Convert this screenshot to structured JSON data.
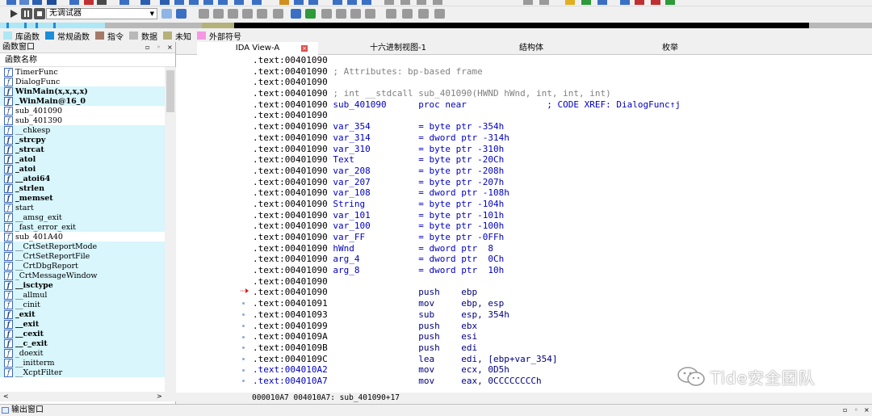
{
  "toolbar": {
    "debugger_select": "无调试器"
  },
  "nav_legend": [
    {
      "label": "库函数",
      "color": "#aee7f5"
    },
    {
      "label": "常规函数",
      "color": "#1a8ed8"
    },
    {
      "label": "指令",
      "color": "#a5786a"
    },
    {
      "label": "数据",
      "color": "#b8b8b8"
    },
    {
      "label": "未知",
      "color": "#b5b17a"
    },
    {
      "label": "外部符号",
      "color": "#f598e3"
    }
  ],
  "functions_window": {
    "title": "函数窗口",
    "column_header": "函数名称",
    "items": [
      {
        "name": "TimerFunc",
        "lib": false,
        "bold": false
      },
      {
        "name": "DialogFunc",
        "lib": false,
        "bold": false
      },
      {
        "name": "WinMain(x,x,x,x)",
        "lib": true,
        "bold": true
      },
      {
        "name": "_WinMain@16_0",
        "lib": true,
        "bold": true
      },
      {
        "name": "sub_401090",
        "lib": false,
        "bold": false
      },
      {
        "name": "sub_401390",
        "lib": false,
        "bold": false
      },
      {
        "name": "__chkesp",
        "lib": true,
        "bold": false
      },
      {
        "name": "_strcpy",
        "lib": true,
        "bold": true
      },
      {
        "name": "_strcat",
        "lib": true,
        "bold": true
      },
      {
        "name": "_atol",
        "lib": true,
        "bold": true
      },
      {
        "name": "_atoi",
        "lib": true,
        "bold": true
      },
      {
        "name": "__atoi64",
        "lib": true,
        "bold": true
      },
      {
        "name": "_strlen",
        "lib": true,
        "bold": true
      },
      {
        "name": "_memset",
        "lib": true,
        "bold": true
      },
      {
        "name": "start",
        "lib": true,
        "bold": false
      },
      {
        "name": "__amsg_exit",
        "lib": true,
        "bold": false
      },
      {
        "name": "_fast_error_exit",
        "lib": true,
        "bold": false
      },
      {
        "name": "sub_401A40",
        "lib": false,
        "bold": false
      },
      {
        "name": "__CrtSetReportMode",
        "lib": true,
        "bold": false
      },
      {
        "name": "__CrtSetReportFile",
        "lib": true,
        "bold": false
      },
      {
        "name": "__CrtDbgReport",
        "lib": true,
        "bold": false
      },
      {
        "name": "_CrtMessageWindow",
        "lib": true,
        "bold": false
      },
      {
        "name": "__isctype",
        "lib": true,
        "bold": true
      },
      {
        "name": "__allmul",
        "lib": true,
        "bold": false
      },
      {
        "name": "__cinit",
        "lib": true,
        "bold": false
      },
      {
        "name": "_exit",
        "lib": true,
        "bold": true
      },
      {
        "name": "__exit",
        "lib": true,
        "bold": true
      },
      {
        "name": "__cexit",
        "lib": true,
        "bold": true
      },
      {
        "name": "__c_exit",
        "lib": true,
        "bold": true
      },
      {
        "name": "_doexit",
        "lib": true,
        "bold": false
      },
      {
        "name": "__initterm",
        "lib": true,
        "bold": false
      },
      {
        "name": "__XcptFilter",
        "lib": true,
        "bold": false
      }
    ]
  },
  "tabs": [
    {
      "label": "IDA View-A"
    },
    {
      "label": "十六进制视图-1"
    },
    {
      "label": "结构体"
    },
    {
      "label": "枚举"
    }
  ],
  "code_lines": [
    {
      "addr": ".text:00401090",
      "body": ""
    },
    {
      "addr": ".text:00401090",
      "body": "; Attributes: bp-based frame"
    },
    {
      "addr": ".text:00401090",
      "body": ""
    },
    {
      "addr": ".text:00401090",
      "body": "; int __stdcall sub_401090(HWND hWnd, int, int, int)"
    },
    {
      "addr": ".text:00401090",
      "body": "sub_401090      proc near               ; CODE XREF: DialogFunc↑j"
    },
    {
      "addr": ".text:00401090",
      "body": ""
    },
    {
      "addr": ".text:00401090",
      "body": "var_354         = byte ptr -354h"
    },
    {
      "addr": ".text:00401090",
      "body": "var_314         = dword ptr -314h"
    },
    {
      "addr": ".text:00401090",
      "body": "var_310         = byte ptr -310h"
    },
    {
      "addr": ".text:00401090",
      "body": "Text            = byte ptr -20Ch"
    },
    {
      "addr": ".text:00401090",
      "body": "var_208         = byte ptr -208h"
    },
    {
      "addr": ".text:00401090",
      "body": "var_207         = byte ptr -207h"
    },
    {
      "addr": ".text:00401090",
      "body": "var_108         = dword ptr -108h"
    },
    {
      "addr": ".text:00401090",
      "body": "String          = byte ptr -104h"
    },
    {
      "addr": ".text:00401090",
      "body": "var_101         = byte ptr -101h"
    },
    {
      "addr": ".text:00401090",
      "body": "var_100         = byte ptr -100h"
    },
    {
      "addr": ".text:00401090",
      "body": "var_FF          = byte ptr -0FFh"
    },
    {
      "addr": ".text:00401090",
      "body": "hWnd            = dword ptr  8"
    },
    {
      "addr": ".text:00401090",
      "body": "arg_4           = dword ptr  0Ch"
    },
    {
      "addr": ".text:00401090",
      "body": "arg_8           = dword ptr  10h"
    },
    {
      "addr": ".text:00401090",
      "body": ""
    },
    {
      "addr": ".text:00401090",
      "body": "                push    ebp"
    },
    {
      "addr": ".text:00401091",
      "body": "                mov     ebp, esp"
    },
    {
      "addr": ".text:00401093",
      "body": "                sub     esp, 354h"
    },
    {
      "addr": ".text:00401099",
      "body": "                push    ebx"
    },
    {
      "addr": ".text:0040109A",
      "body": "                push    esi"
    },
    {
      "addr": ".text:0040109B",
      "body": "                push    edi"
    },
    {
      "addr": ".text:0040109C",
      "body": "                lea     edi, [ebp+var_354]"
    },
    {
      "addr": ".text:004010A2",
      "body": "                mov     ecx, 0D5h"
    },
    {
      "addr": ".text:004010A7",
      "body": "                mov     eax, 0CCCCCCCCh"
    }
  ],
  "status_bar": "000010A7 004010A7: sub_401090+17",
  "output_window": {
    "title": "输出窗口"
  },
  "watermark": "Tide安全团队"
}
